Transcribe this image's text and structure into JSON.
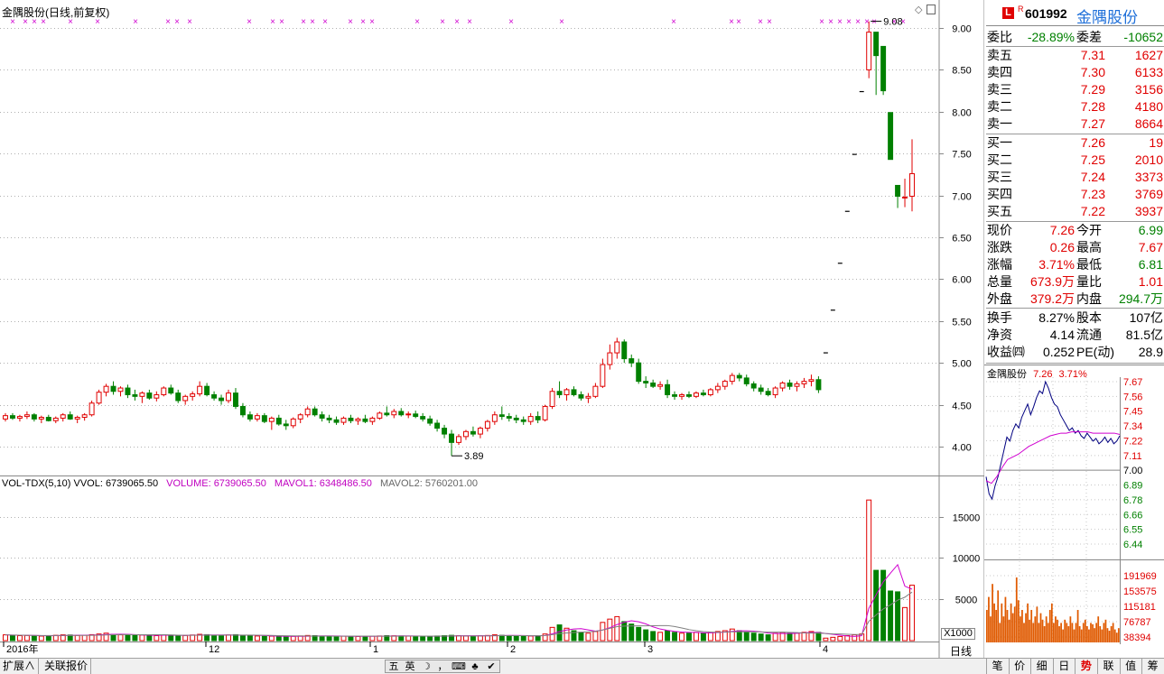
{
  "main": {
    "title": "金隅股份(日线,前复权)",
    "price_axis": [
      "9.00",
      "8.50",
      "8.00",
      "7.50",
      "7.00",
      "6.50",
      "6.00",
      "5.50",
      "5.00",
      "4.50",
      "4.00"
    ],
    "high_marker": "9.08",
    "low_marker": "3.89"
  },
  "volume": {
    "indicator": "VOL-TDX(5,10)",
    "vvol": "VVOL: 6739065.50",
    "volume": "VOLUME: 6739065.50",
    "mavol1": "MAVOL1: 6348486.50",
    "mavol2": "MAVOL2: 5760201.00",
    "axis": [
      "15000",
      "10000",
      "5000"
    ],
    "unit": "X1000",
    "time_labels": [
      "2016年",
      "12",
      "1",
      "2",
      "3",
      "4"
    ],
    "period": "日线"
  },
  "quote": {
    "badge_l": "L",
    "badge_r": "R",
    "code": "601992",
    "name": "金隅股份",
    "weibi_label": "委比",
    "weibi": "-28.89%",
    "weicha_label": "委差",
    "weicha": "-10652",
    "sells": [
      {
        "label": "卖五",
        "price": "7.31",
        "vol": "1627"
      },
      {
        "label": "卖四",
        "price": "7.30",
        "vol": "6133"
      },
      {
        "label": "卖三",
        "price": "7.29",
        "vol": "3156"
      },
      {
        "label": "卖二",
        "price": "7.28",
        "vol": "4180"
      },
      {
        "label": "卖一",
        "price": "7.27",
        "vol": "8664"
      }
    ],
    "buys": [
      {
        "label": "买一",
        "price": "7.26",
        "vol": "19"
      },
      {
        "label": "买二",
        "price": "7.25",
        "vol": "2010"
      },
      {
        "label": "买三",
        "price": "7.24",
        "vol": "3373"
      },
      {
        "label": "买四",
        "price": "7.23",
        "vol": "3769"
      },
      {
        "label": "买五",
        "price": "7.22",
        "vol": "3937"
      }
    ],
    "stats": [
      {
        "l1": "现价",
        "v1": "7.26",
        "c1": "red",
        "l2": "今开",
        "v2": "6.99",
        "c2": "grn"
      },
      {
        "l1": "涨跌",
        "v1": "0.26",
        "c1": "red",
        "l2": "最高",
        "v2": "7.67",
        "c2": "red"
      },
      {
        "l1": "涨幅",
        "v1": "3.71%",
        "c1": "red",
        "l2": "最低",
        "v2": "6.81",
        "c2": "grn"
      },
      {
        "l1": "总量",
        "v1": "673.9万",
        "c1": "red",
        "l2": "量比",
        "v2": "1.01",
        "c2": "red"
      },
      {
        "l1": "外盘",
        "v1": "379.2万",
        "c1": "red",
        "l2": "内盘",
        "v2": "294.7万",
        "c2": "grn"
      }
    ],
    "fund": [
      {
        "l1": "换手",
        "v1": "8.27%",
        "l2": "股本",
        "v2": "107亿"
      },
      {
        "l1": "净资",
        "v1": "4.14",
        "l2": "流通",
        "v2": "81.5亿"
      },
      {
        "l1": "收益㈣",
        "v1": "0.252",
        "l2": "PE(动)",
        "v2": "28.9"
      }
    ]
  },
  "mini": {
    "name": "金隅股份",
    "price": "7.26",
    "pct": "3.71%",
    "price_axis": [
      {
        "v": "7.67",
        "c": "#e00000"
      },
      {
        "v": "7.56",
        "c": "#e00000"
      },
      {
        "v": "7.45",
        "c": "#e00000"
      },
      {
        "v": "7.34",
        "c": "#e00000"
      },
      {
        "v": "7.22",
        "c": "#e00000"
      },
      {
        "v": "7.11",
        "c": "#e00000"
      },
      {
        "v": "7.00",
        "c": "#000000"
      },
      {
        "v": "6.89",
        "c": "#008000"
      },
      {
        "v": "6.78",
        "c": "#008000"
      },
      {
        "v": "6.66",
        "c": "#008000"
      },
      {
        "v": "6.55",
        "c": "#008000"
      },
      {
        "v": "6.44",
        "c": "#008000"
      }
    ],
    "vol_axis": [
      "191969",
      "153575",
      "115181",
      "76787",
      "38394"
    ]
  },
  "bottom": {
    "expand": "扩展∧",
    "related": "关联报价",
    "ime": [
      "五",
      "英",
      "☽",
      "，",
      "⌨",
      "♣",
      "✔"
    ],
    "tabs": [
      "笔",
      "价",
      "细",
      "日",
      "势",
      "联",
      "值",
      "筹"
    ],
    "active_tab": "势"
  },
  "chart_data": [
    {
      "type": "candlestick",
      "title": "金隅股份(日线,前复权)",
      "ylim": [
        3.7,
        9.2
      ],
      "ticks": [
        9.0,
        8.5,
        8.0,
        7.5,
        7.0,
        6.5,
        6.0,
        5.5,
        5.0,
        4.5,
        4.0
      ],
      "annotations": [
        {
          "text": "9.08",
          "value": 9.08
        },
        {
          "text": "3.89",
          "value": 3.89
        }
      ],
      "x_labels": [
        "2016年",
        "12",
        "1",
        "2",
        "3",
        "4"
      ],
      "ohlc": [
        [
          4.33,
          4.4,
          4.3,
          4.37
        ],
        [
          4.37,
          4.4,
          4.32,
          4.34
        ],
        [
          4.34,
          4.38,
          4.3,
          4.36
        ],
        [
          4.36,
          4.42,
          4.33,
          4.38
        ],
        [
          4.38,
          4.4,
          4.3,
          4.33
        ],
        [
          4.33,
          4.37,
          4.28,
          4.35
        ],
        [
          4.35,
          4.38,
          4.3,
          4.31
        ],
        [
          4.31,
          4.36,
          4.28,
          4.34
        ],
        [
          4.34,
          4.4,
          4.3,
          4.38
        ],
        [
          4.38,
          4.42,
          4.32,
          4.33
        ],
        [
          4.33,
          4.37,
          4.28,
          4.35
        ],
        [
          4.35,
          4.4,
          4.31,
          4.38
        ],
        [
          4.38,
          4.55,
          4.36,
          4.52
        ],
        [
          4.52,
          4.68,
          4.5,
          4.65
        ],
        [
          4.65,
          4.75,
          4.6,
          4.72
        ],
        [
          4.72,
          4.78,
          4.62,
          4.66
        ],
        [
          4.66,
          4.72,
          4.6,
          4.7
        ],
        [
          4.7,
          4.74,
          4.58,
          4.62
        ],
        [
          4.62,
          4.68,
          4.55,
          4.6
        ],
        [
          4.6,
          4.66,
          4.52,
          4.64
        ],
        [
          4.64,
          4.68,
          4.56,
          4.58
        ],
        [
          4.58,
          4.66,
          4.54,
          4.62
        ],
        [
          4.62,
          4.72,
          4.6,
          4.7
        ],
        [
          4.7,
          4.74,
          4.62,
          4.64
        ],
        [
          4.64,
          4.68,
          4.52,
          4.55
        ],
        [
          4.55,
          4.62,
          4.5,
          4.6
        ],
        [
          4.6,
          4.66,
          4.55,
          4.63
        ],
        [
          4.63,
          4.78,
          4.6,
          4.72
        ],
        [
          4.72,
          4.76,
          4.6,
          4.62
        ],
        [
          4.62,
          4.66,
          4.55,
          4.58
        ],
        [
          4.58,
          4.62,
          4.5,
          4.55
        ],
        [
          4.55,
          4.68,
          4.52,
          4.64
        ],
        [
          4.64,
          4.7,
          4.45,
          4.48
        ],
        [
          4.48,
          4.52,
          4.35,
          4.38
        ],
        [
          4.38,
          4.42,
          4.3,
          4.33
        ],
        [
          4.33,
          4.4,
          4.3,
          4.37
        ],
        [
          4.37,
          4.4,
          4.28,
          4.3
        ],
        [
          4.3,
          4.36,
          4.2,
          4.34
        ],
        [
          4.34,
          4.38,
          4.25,
          4.27
        ],
        [
          4.27,
          4.32,
          4.2,
          4.25
        ],
        [
          4.25,
          4.35,
          4.22,
          4.33
        ],
        [
          4.33,
          4.4,
          4.28,
          4.38
        ],
        [
          4.38,
          4.48,
          4.35,
          4.45
        ],
        [
          4.45,
          4.48,
          4.36,
          4.38
        ],
        [
          4.38,
          4.42,
          4.3,
          4.34
        ],
        [
          4.34,
          4.38,
          4.28,
          4.32
        ],
        [
          4.32,
          4.36,
          4.26,
          4.29
        ],
        [
          4.29,
          4.36,
          4.26,
          4.34
        ],
        [
          4.34,
          4.38,
          4.28,
          4.31
        ],
        [
          4.31,
          4.35,
          4.26,
          4.33
        ],
        [
          4.33,
          4.38,
          4.28,
          4.3
        ],
        [
          4.3,
          4.36,
          4.26,
          4.34
        ],
        [
          4.34,
          4.42,
          4.32,
          4.4
        ],
        [
          4.4,
          4.48,
          4.36,
          4.38
        ],
        [
          4.38,
          4.45,
          4.34,
          4.42
        ],
        [
          4.42,
          4.46,
          4.36,
          4.38
        ],
        [
          4.38,
          4.42,
          4.34,
          4.39
        ],
        [
          4.39,
          4.43,
          4.34,
          4.36
        ],
        [
          4.36,
          4.4,
          4.3,
          4.33
        ],
        [
          4.33,
          4.37,
          4.25,
          4.28
        ],
        [
          4.28,
          4.32,
          4.18,
          4.22
        ],
        [
          4.22,
          4.26,
          4.1,
          4.15
        ],
        [
          4.15,
          4.2,
          3.89,
          4.05
        ],
        [
          4.05,
          4.15,
          4.02,
          4.12
        ],
        [
          4.12,
          4.2,
          4.08,
          4.18
        ],
        [
          4.18,
          4.24,
          4.12,
          4.15
        ],
        [
          4.15,
          4.24,
          4.1,
          4.22
        ],
        [
          4.22,
          4.32,
          4.18,
          4.3
        ],
        [
          4.3,
          4.42,
          4.26,
          4.38
        ],
        [
          4.38,
          4.48,
          4.32,
          4.36
        ],
        [
          4.36,
          4.4,
          4.3,
          4.34
        ],
        [
          4.34,
          4.38,
          4.28,
          4.32
        ],
        [
          4.32,
          4.36,
          4.26,
          4.3
        ],
        [
          4.3,
          4.4,
          4.26,
          4.36
        ],
        [
          4.36,
          4.42,
          4.28,
          4.32
        ],
        [
          4.32,
          4.5,
          4.3,
          4.48
        ],
        [
          4.48,
          4.7,
          4.45,
          4.66
        ],
        [
          4.66,
          4.78,
          4.58,
          4.62
        ],
        [
          4.62,
          4.7,
          4.55,
          4.68
        ],
        [
          4.68,
          4.72,
          4.6,
          4.62
        ],
        [
          4.62,
          4.66,
          4.55,
          4.58
        ],
        [
          4.58,
          4.64,
          4.52,
          4.6
        ],
        [
          4.6,
          4.76,
          4.58,
          4.72
        ],
        [
          4.72,
          5.05,
          4.7,
          4.98
        ],
        [
          4.98,
          5.22,
          4.92,
          5.12
        ],
        [
          5.12,
          5.3,
          5.05,
          5.25
        ],
        [
          5.25,
          5.28,
          5.0,
          5.05
        ],
        [
          5.05,
          5.1,
          4.95,
          5.0
        ],
        [
          5.0,
          5.05,
          4.75,
          4.78
        ],
        [
          4.78,
          4.84,
          4.7,
          4.76
        ],
        [
          4.76,
          4.8,
          4.7,
          4.72
        ],
        [
          4.72,
          4.78,
          4.68,
          4.74
        ],
        [
          4.74,
          4.8,
          4.58,
          4.62
        ],
        [
          4.62,
          4.66,
          4.56,
          4.6
        ],
        [
          4.6,
          4.64,
          4.56,
          4.62
        ],
        [
          4.62,
          4.66,
          4.58,
          4.6
        ],
        [
          4.6,
          4.66,
          4.58,
          4.64
        ],
        [
          4.64,
          4.68,
          4.6,
          4.62
        ],
        [
          4.62,
          4.7,
          4.6,
          4.68
        ],
        [
          4.68,
          4.76,
          4.64,
          4.72
        ],
        [
          4.72,
          4.8,
          4.68,
          4.78
        ],
        [
          4.78,
          4.88,
          4.74,
          4.85
        ],
        [
          4.85,
          4.88,
          4.78,
          4.82
        ],
        [
          4.82,
          4.86,
          4.72,
          4.75
        ],
        [
          4.75,
          4.78,
          4.66,
          4.7
        ],
        [
          4.7,
          4.74,
          4.62,
          4.66
        ],
        [
          4.66,
          4.7,
          4.6,
          4.62
        ],
        [
          4.62,
          4.72,
          4.58,
          4.7
        ],
        [
          4.7,
          4.78,
          4.66,
          4.76
        ],
        [
          4.76,
          4.8,
          4.68,
          4.72
        ],
        [
          4.72,
          4.78,
          4.66,
          4.75
        ],
        [
          4.75,
          4.82,
          4.7,
          4.78
        ],
        [
          4.78,
          4.86,
          4.72,
          4.8
        ],
        [
          4.8,
          4.84,
          4.64,
          4.68
        ],
        [
          5.12,
          5.12,
          5.12,
          5.12
        ],
        [
          5.63,
          5.63,
          5.63,
          5.63
        ],
        [
          6.19,
          6.19,
          6.19,
          6.19
        ],
        [
          6.81,
          6.81,
          6.81,
          6.81
        ],
        [
          7.49,
          7.49,
          7.49,
          7.49
        ],
        [
          8.24,
          8.24,
          8.24,
          8.24
        ],
        [
          8.5,
          9.08,
          8.4,
          8.95
        ],
        [
          8.95,
          8.95,
          8.2,
          8.67
        ],
        [
          8.78,
          8.78,
          8.2,
          8.25
        ],
        [
          7.99,
          7.99,
          7.43,
          7.43
        ],
        [
          7.12,
          7.12,
          6.85,
          6.99
        ],
        [
          6.98,
          7.2,
          6.86,
          6.98
        ],
        [
          6.99,
          7.67,
          6.81,
          7.26
        ]
      ]
    },
    {
      "type": "bar",
      "title": "VOL-TDX(5,10)",
      "ylabel": "X1000",
      "ylim": [
        0,
        18000
      ],
      "series": [
        {
          "name": "VOLUME",
          "values": [
            700,
            650,
            600,
            620,
            580,
            550,
            600,
            640,
            700,
            680,
            620,
            650,
            720,
            800,
            900,
            760,
            700,
            650,
            620,
            680,
            640,
            600,
            700,
            650,
            600,
            620,
            680,
            760,
            720,
            640,
            600,
            680,
            720,
            640,
            600,
            560,
            520,
            540,
            500,
            480,
            520,
            560,
            620,
            600,
            540,
            520,
            500,
            540,
            520,
            500,
            520,
            540,
            560,
            600,
            580,
            560,
            540,
            520,
            500,
            520,
            560,
            600,
            640,
            600,
            560,
            540,
            580,
            620,
            700,
            640,
            600,
            560,
            540,
            560,
            600,
            800,
            1600,
            1900,
            1500,
            1200,
            1000,
            900,
            1100,
            2200,
            2600,
            2900,
            2300,
            2000,
            1600,
            1300,
            1100,
            1000,
            1200,
            1000,
            900,
            900,
            1000,
            900,
            1000,
            1100,
            1200,
            1400,
            1200,
            1000,
            900,
            800,
            700,
            900,
            1000,
            900,
            900,
            1000,
            1100,
            1000,
            300,
            400,
            500,
            600,
            700,
            800,
            17000,
            8500,
            8500,
            6000,
            5900,
            4000,
            6700
          ]
        },
        {
          "name": "MAVOL1",
          "values": []
        },
        {
          "name": "MAVOL2",
          "values": []
        }
      ]
    }
  ]
}
